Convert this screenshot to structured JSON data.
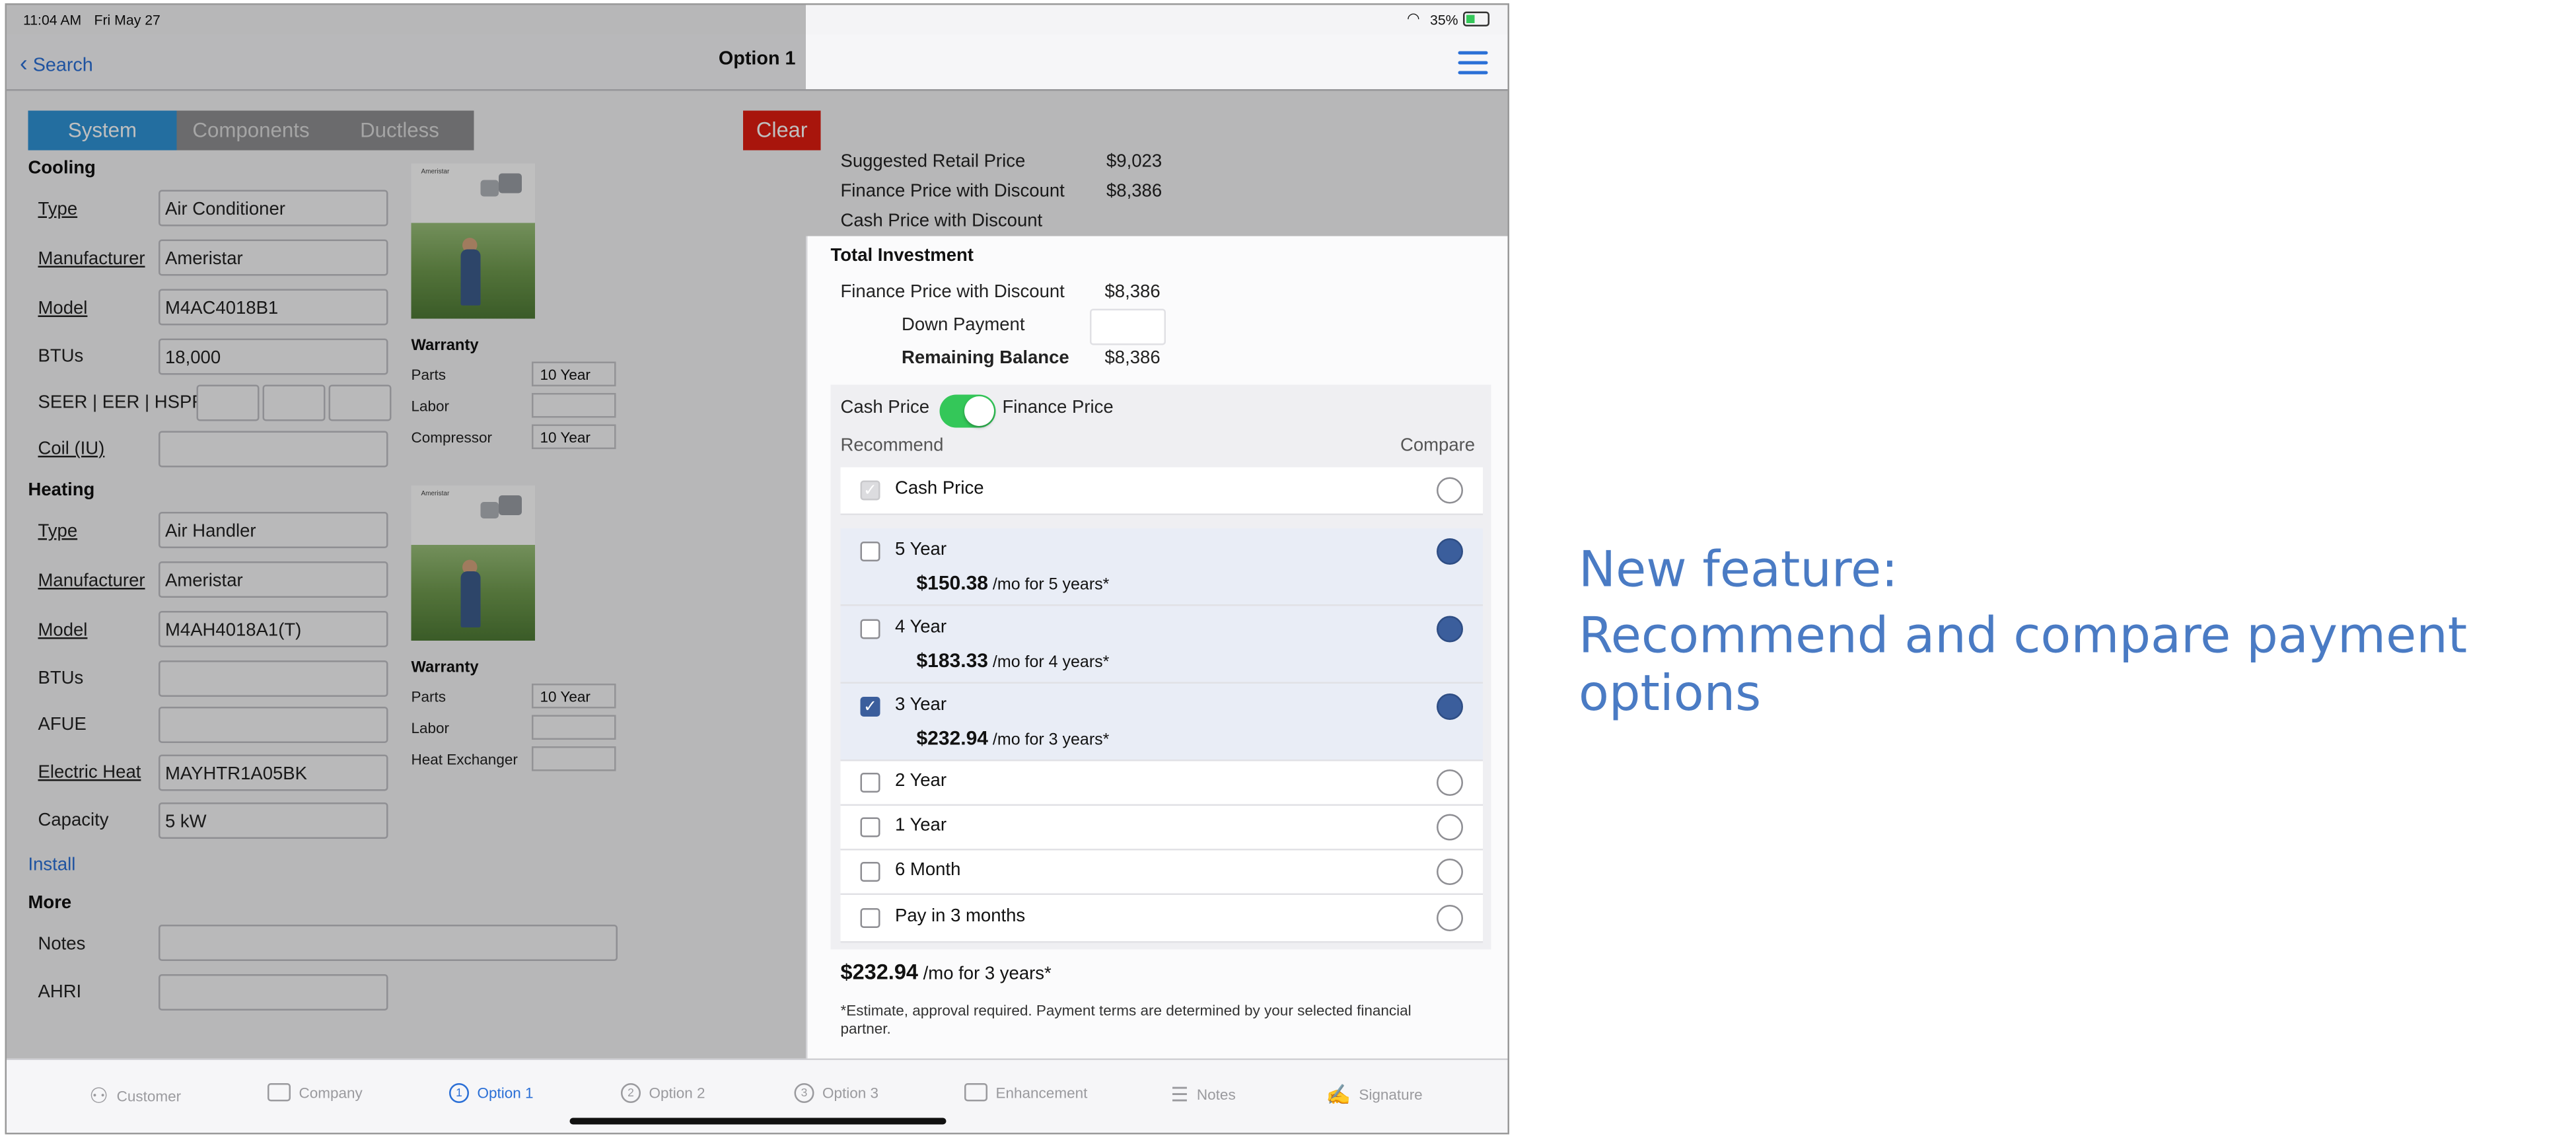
{
  "status_bar": {
    "time": "11:04 AM",
    "date": "Fri May 27",
    "battery": "35%"
  },
  "nav": {
    "back_label": "Search",
    "title": "Option 1"
  },
  "segments": [
    {
      "label": "System",
      "selected": true
    },
    {
      "label": "Components",
      "selected": false
    },
    {
      "label": "Ductless",
      "selected": false
    }
  ],
  "clear_label": "Clear",
  "cooling": {
    "section": "Cooling",
    "type_label": "Type",
    "type_value": "Air Conditioner",
    "manufacturer_label": "Manufacturer",
    "manufacturer_value": "Ameristar",
    "model_label": "Model",
    "model_value": "M4AC4018B1",
    "btus_label": "BTUs",
    "btus_value": "18,000",
    "seer_label": "SEER | EER | HSPF",
    "coil_label": "Coil (IU)",
    "warranty_title": "Warranty",
    "parts_label": "Parts",
    "parts_value": "10 Year",
    "labor_label": "Labor",
    "compressor_label": "Compressor",
    "compressor_value": "10 Year"
  },
  "heating": {
    "section": "Heating",
    "type_label": "Type",
    "type_value": "Air Handler",
    "manufacturer_label": "Manufacturer",
    "manufacturer_value": "Ameristar",
    "model_label": "Model",
    "model_value": "M4AH4018A1(T)",
    "btus_label": "BTUs",
    "afue_label": "AFUE",
    "electric_heat_label": "Electric Heat",
    "electric_heat_value": "MAYHTR1A05BK",
    "capacity_label": "Capacity",
    "capacity_value": "5 kW",
    "warranty_title": "Warranty",
    "parts_label": "Parts",
    "parts_value": "10 Year",
    "labor_label": "Labor",
    "heat_exchanger_label": "Heat Exchanger"
  },
  "install_link": "Install",
  "more": {
    "section": "More",
    "notes_label": "Notes",
    "ahri_label": "AHRI"
  },
  "pricing_top": {
    "suggested_label": "Suggested Retail Price",
    "suggested_value": "$9,023",
    "finance_label": "Finance Price with Discount",
    "finance_value": "$8,386",
    "cash_label": "Cash Price with Discount"
  },
  "investment": {
    "title": "Total Investment",
    "finance_label": "Finance Price with Discount",
    "finance_value": "$8,386",
    "down_label": "Down Payment",
    "remaining_label": "Remaining Balance",
    "remaining_value": "$8,386"
  },
  "toggle": {
    "left_label": "Cash Price",
    "right_label": "Finance Price",
    "on": true
  },
  "table_headers": {
    "recommend": "Recommend",
    "compare": "Compare"
  },
  "options": [
    {
      "label": "Cash Price",
      "recommend": true,
      "compare": false,
      "disabled": true
    },
    {
      "label": "5 Year",
      "amount": "$150.38",
      "term": "/mo for 5 years*",
      "recommend": false,
      "compare": true
    },
    {
      "label": "4 Year",
      "amount": "$183.33",
      "term": "/mo for 4 years*",
      "recommend": false,
      "compare": true
    },
    {
      "label": "3 Year",
      "amount": "$232.94",
      "term": "/mo for 3 years*",
      "recommend": true,
      "compare": true
    },
    {
      "label": "2 Year",
      "recommend": false,
      "compare": false
    },
    {
      "label": "1 Year",
      "recommend": false,
      "compare": false
    },
    {
      "label": "6 Month",
      "recommend": false,
      "compare": false
    },
    {
      "label": "Pay in 3 months",
      "recommend": false,
      "compare": false
    }
  ],
  "summary": {
    "amount": "$232.94",
    "term": "/mo for 3 years*"
  },
  "disclaimer": "*Estimate, approval required. Payment terms are determined by your selected financial partner.",
  "tabbar": [
    {
      "label": "Customer",
      "icon": "person-icon"
    },
    {
      "label": "Company",
      "icon": "truck-icon"
    },
    {
      "label": "Option 1",
      "icon": "1",
      "selected": true
    },
    {
      "label": "Option 2",
      "icon": "2"
    },
    {
      "label": "Option 3",
      "icon": "3"
    },
    {
      "label": "Enhancement",
      "icon": "invoice-icon"
    },
    {
      "label": "Notes",
      "icon": "list-icon"
    },
    {
      "label": "Signature",
      "icon": "signature-icon"
    }
  ],
  "caption": {
    "line1": "New feature:",
    "line2": "Recommend and compare payment options"
  },
  "colors": {
    "accent": "#2a6fd6",
    "segment_selected": "#2f93d6",
    "clear": "#e01d10",
    "toggle_on": "#34c759",
    "radio_on": "#3b5e9c",
    "caption": "#4a7bc4"
  }
}
